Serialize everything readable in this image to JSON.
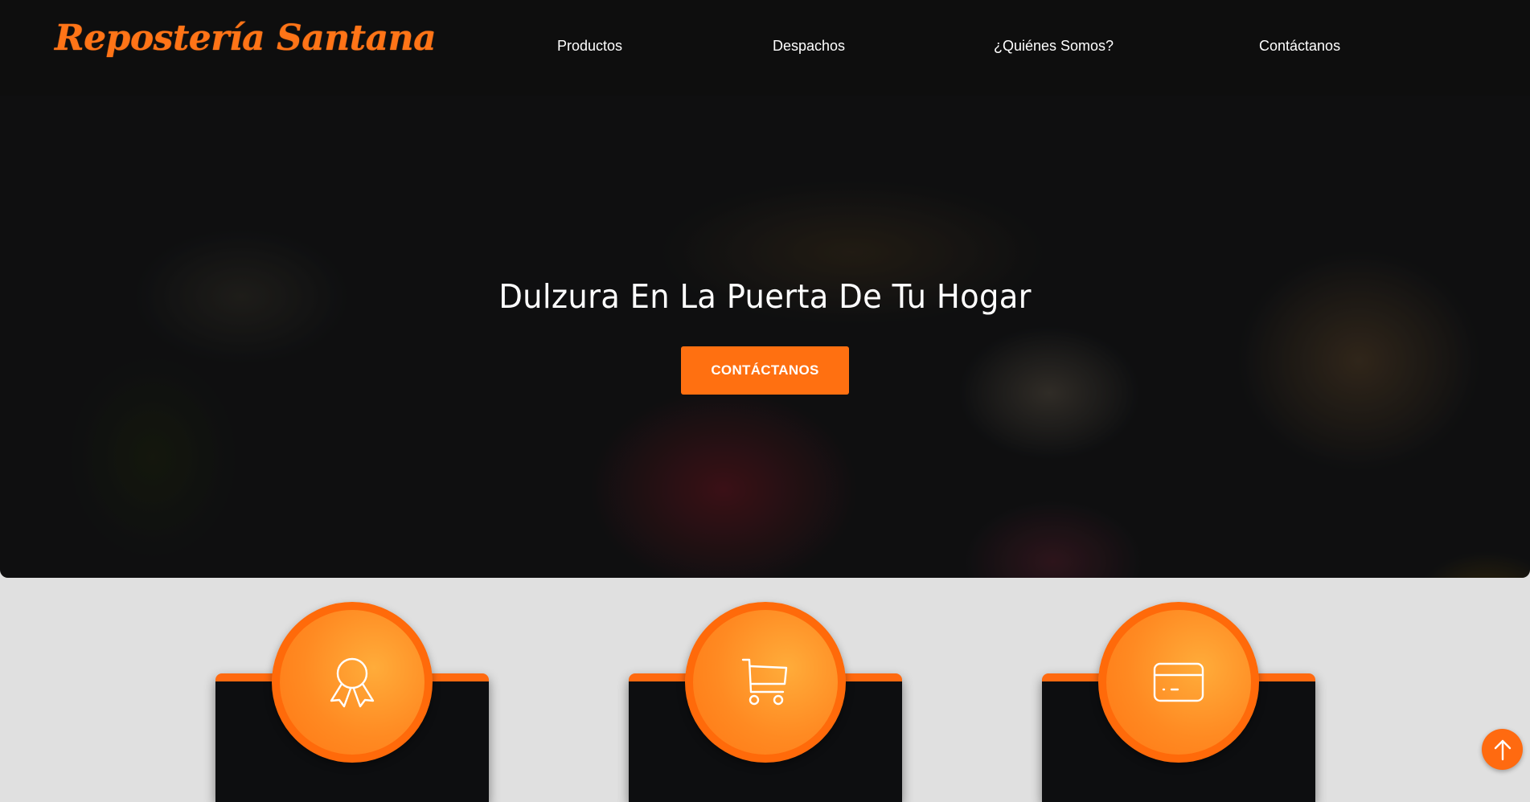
{
  "brand": {
    "name": "Repostería Santana",
    "accent": "#ff7417"
  },
  "nav": {
    "items": [
      {
        "label": "Productos"
      },
      {
        "label": "Despachos"
      },
      {
        "label": "¿Quiénes Somos?"
      },
      {
        "label": "Contáctanos"
      }
    ]
  },
  "hero": {
    "title": "Dulzura En La Puerta De Tu Hogar",
    "cta_label": "CONTÁCTANOS",
    "cta_color": "#ff7011"
  },
  "features": [
    {
      "icon": "award-ribbon-icon"
    },
    {
      "icon": "shopping-cart-icon"
    },
    {
      "icon": "credit-card-icon"
    }
  ],
  "back_to_top": {
    "icon": "arrow-up-icon"
  }
}
